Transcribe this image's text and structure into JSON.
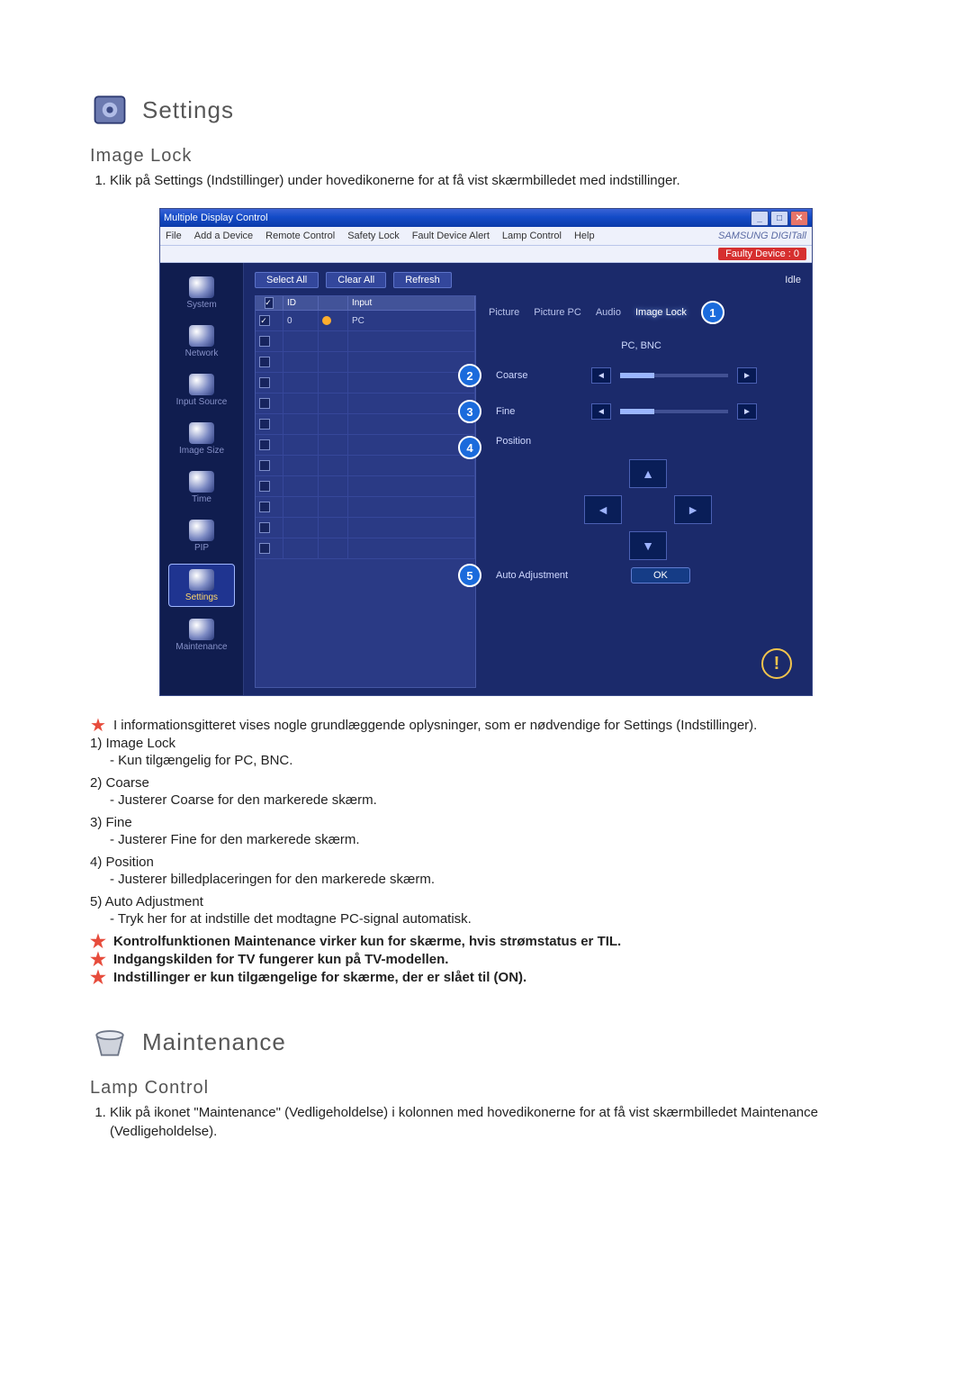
{
  "settings": {
    "header_title": "Settings",
    "image_lock_title": "Image Lock",
    "intro_item": "Klik på Settings (Indstillinger) under hovedikonerne for at få vist skærmbilledet med indstillinger.",
    "star_note_grid": "I informationsgitteret vises nogle grundlæggende oplysninger, som er nødvendige for Settings (Indstillinger).",
    "items": {
      "n1_label": "1) Image Lock",
      "n1_sub": "- Kun tilgængelig for PC, BNC.",
      "n2_label": "2) Coarse",
      "n2_sub": "- Justerer Coarse for den markerede skærm.",
      "n3_label": "3) Fine",
      "n3_sub": "- Justerer Fine for den markerede skærm.",
      "n4_label": "4) Position",
      "n4_sub": "- Justerer billedplaceringen for den markerede skærm.",
      "n5_label": "5) Auto Adjustment",
      "n5_sub": "- Tryk her for at indstille det modtagne PC-signal automatisk."
    },
    "star_maint": "Kontrolfunktionen Maintenance virker kun for skærme, hvis strømstatus er TIL.",
    "star_tv": "Indgangskilden for TV fungerer kun på TV-modellen.",
    "star_on": "Indstillinger er kun tilgængelige for skærme, der er slået til (ON)."
  },
  "maintenance": {
    "header_title": "Maintenance",
    "lamp_title": "Lamp Control",
    "intro_item": "Klik på ikonet \"Maintenance\" (Vedligeholdelse) i kolonnen med hovedikonerne for at få vist skærmbilledet Maintenance (Vedligeholdelse)."
  },
  "app": {
    "title": "Multiple Display Control",
    "menu": {
      "file": "File",
      "add_device": "Add a Device",
      "remote": "Remote Control",
      "safety": "Safety Lock",
      "fault_alert": "Fault Device Alert",
      "lamp": "Lamp Control",
      "help": "Help",
      "brand": "SAMSUNG DIGITall"
    },
    "fault_badge": "Faulty Device : 0",
    "sidebar": {
      "system": "System",
      "network": "Network",
      "input_source": "Input Source",
      "image_size": "Image Size",
      "time": "Time",
      "pip": "PIP",
      "settings": "Settings",
      "maintenance": "Maintenance"
    },
    "toolbar": {
      "select_all": "Select All",
      "clear_all": "Clear All",
      "refresh": "Refresh",
      "idle": "Idle"
    },
    "grid": {
      "h_id": "ID",
      "h_input": "Input",
      "row_id": "0",
      "row_input": "PC"
    },
    "tabs": {
      "picture": "Picture",
      "picture_pc": "Picture PC",
      "audio": "Audio",
      "image_lock": "Image Lock"
    },
    "panel": {
      "mode": "PC, BNC",
      "coarse": "Coarse",
      "fine": "Fine",
      "position": "Position",
      "auto_adj": "Auto Adjustment",
      "ok": "OK"
    },
    "callouts": {
      "c1": "1",
      "c2": "2",
      "c3": "3",
      "c4": "4",
      "c5": "5"
    }
  }
}
